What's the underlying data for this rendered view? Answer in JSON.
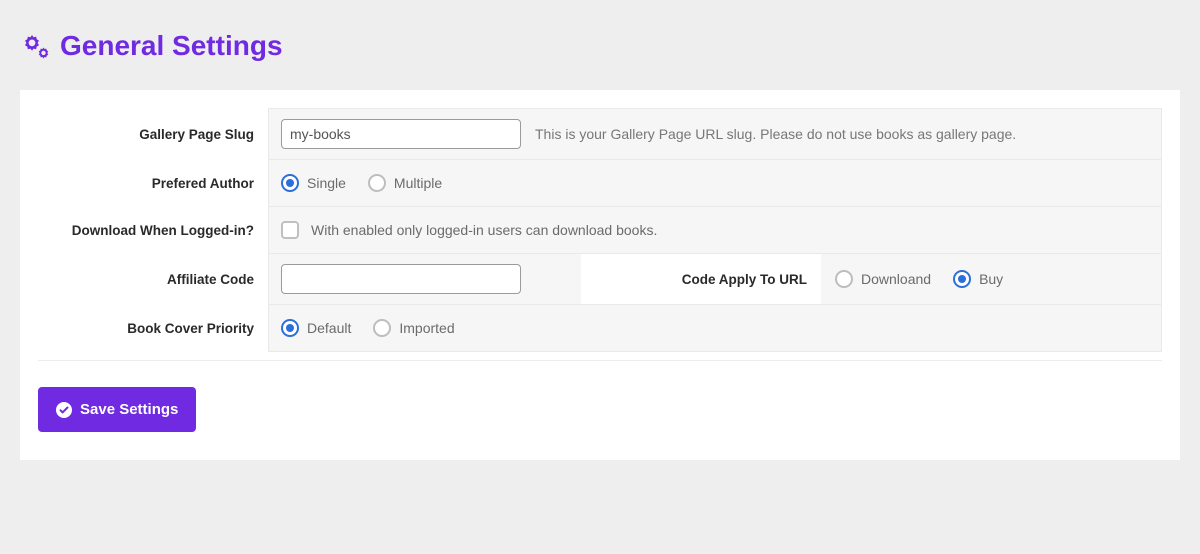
{
  "header": {
    "title": "General Settings"
  },
  "labels": {
    "gallery_slug": "Gallery Page Slug",
    "pref_author": "Prefered Author",
    "download_logged": "Download When Logged-in?",
    "affiliate_code": "Affiliate Code",
    "code_apply": "Code Apply To URL",
    "cover_priority": "Book Cover Priority"
  },
  "gallery": {
    "value": "my-books",
    "hint": "This is your Gallery Page URL slug. Please do not use books as gallery page."
  },
  "pref_author": {
    "single": "Single",
    "multiple": "Multiple",
    "selected": "single"
  },
  "download_logged": {
    "checked": false,
    "text": "With enabled only logged-in users can download books."
  },
  "affiliate": {
    "value": "",
    "apply": {
      "download": "Downloand",
      "buy": "Buy",
      "selected": "buy"
    }
  },
  "cover_priority": {
    "default": "Default",
    "imported": "Imported",
    "selected": "default"
  },
  "actions": {
    "save": "Save Settings"
  }
}
